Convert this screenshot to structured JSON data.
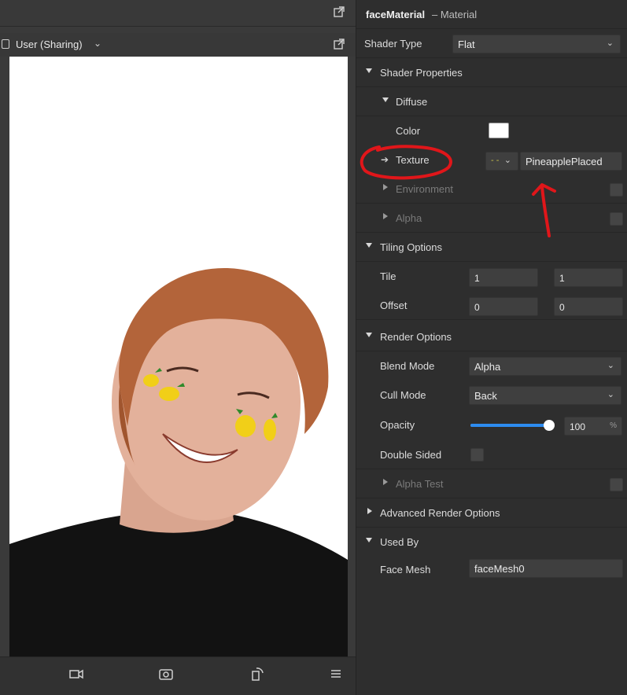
{
  "viewport": {
    "title": "User (Sharing)",
    "bottom_icons": [
      "video-camera-icon",
      "screenshot-camera-icon",
      "rotate-device-icon",
      "menu-icon"
    ]
  },
  "inspector": {
    "object_name": "faceMaterial",
    "object_kind": "– Material",
    "shader_type_label": "Shader Type",
    "shader_type_value": "Flat",
    "shader_properties_label": "Shader Properties",
    "diffuse_label": "Diffuse",
    "color_label": "Color",
    "color_value": "#ffffff",
    "texture_label": "Texture",
    "texture_value": "PineapplePlaced",
    "environment_label": "Environment",
    "alpha_label": "Alpha",
    "tiling_options_label": "Tiling Options",
    "tile_label": "Tile",
    "tile_x": "1",
    "tile_y": "1",
    "offset_label": "Offset",
    "offset_x": "0",
    "offset_y": "0",
    "render_options_label": "Render Options",
    "blend_mode_label": "Blend Mode",
    "blend_mode_value": "Alpha",
    "cull_mode_label": "Cull Mode",
    "cull_mode_value": "Back",
    "opacity_label": "Opacity",
    "opacity_value": "100",
    "opacity_unit": "%",
    "opacity_fraction": 1.0,
    "double_sided_label": "Double Sided",
    "alpha_test_label": "Alpha Test",
    "advanced_render_label": "Advanced Render Options",
    "used_by_label": "Used By",
    "face_mesh_label": "Face Mesh",
    "face_mesh_value": "faceMesh0"
  },
  "colors": {
    "accent": "#2d8cf0",
    "annotation": "#e0161a"
  }
}
